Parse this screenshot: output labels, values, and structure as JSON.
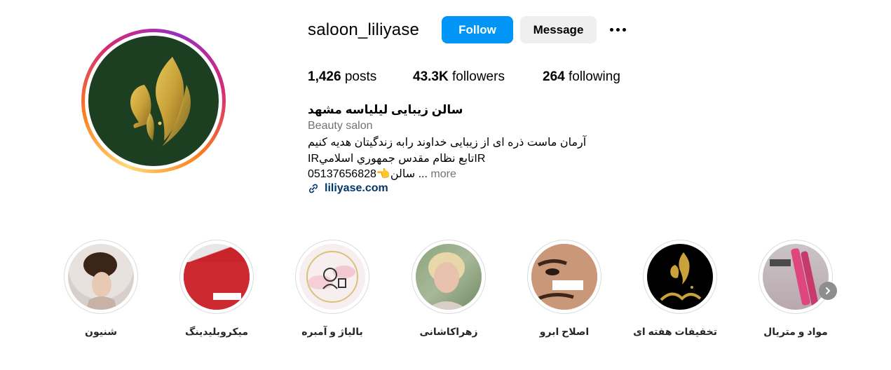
{
  "profile": {
    "username": "saloon_liliyase",
    "follow_label": "Follow",
    "message_label": "Message",
    "posts_count": "1,426",
    "posts_label": "posts",
    "followers_count": "43.3K",
    "followers_label": "followers",
    "following_count": "264",
    "following_label": "following"
  },
  "bio": {
    "name": "سالن زیبایی لیلیاسه مشهد",
    "category": "Beauty salon",
    "line1": "آرمان ماست ذره ای از زیبایی خداوند رابه زندگیتان هدیه کنیم",
    "line2": "IRتابع نظام مقدس جمهوري اسلاميIR",
    "line3": "05137656828👈سالن ...",
    "more": "more",
    "link": "liliyase.com"
  },
  "highlights": [
    {
      "label": "شنیون"
    },
    {
      "label": "میکروبلیدینگ"
    },
    {
      "label": "بالیاژ و آمبره"
    },
    {
      "label": "زهراکاشانی"
    },
    {
      "label": "اصلاح ابرو"
    },
    {
      "label": "تخفیفات هفته ای"
    },
    {
      "label": "مواد و متریال"
    }
  ],
  "colors": {
    "follow_button": "#0095f6",
    "avatar_background": "#1c3f22",
    "gold": "#c9a23a",
    "link": "#00376b"
  },
  "icons": [
    "link-icon",
    "more-options-icon",
    "chevron-right-icon"
  ]
}
